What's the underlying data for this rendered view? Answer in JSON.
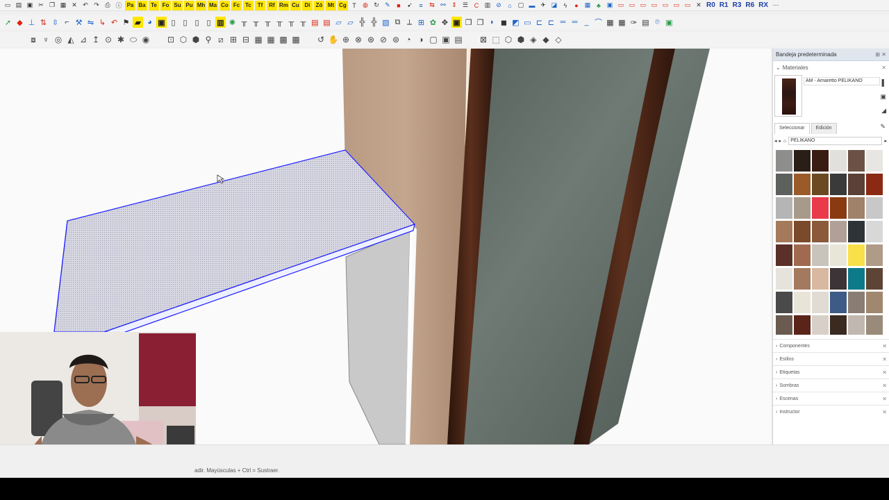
{
  "toolbars": {
    "row1_codes": [
      "Pa",
      "Ba",
      "Te",
      "Fo",
      "Su",
      "Pu",
      "Mh",
      "Ma",
      "Co",
      "Fc",
      "Tc",
      "Tf",
      "Rf",
      "Rm",
      "Cu",
      "Di",
      "Zó",
      "Mt",
      "Cg"
    ],
    "row1_right_codes": [
      "R0",
      "R1",
      "R3",
      "R6",
      "RX"
    ]
  },
  "tray": {
    "title": "Bandeja predeterminada",
    "materials": {
      "section_label": "Materiales",
      "current_material": "AM - Amaretto PELIKANO",
      "tabs": [
        "Seleccionar",
        "Edición"
      ],
      "library": "PELIKANO",
      "swatch_colors": [
        "#8e8e8c",
        "#2a1e18",
        "#3a1d12",
        "#e2e0dc",
        "#6b5245",
        "#e8e6e2",
        "#5c615e",
        "#9a5a2a",
        "#6b4a22",
        "#3a3a3a",
        "#5a4036",
        "#8a2a14",
        "#b5b5b5",
        "#a89a8a",
        "#e83a4a",
        "#8a3a10",
        "#a0826a",
        "#c8c8c8",
        "#a47a5a",
        "#7a4a2a",
        "#8a5a3a",
        "#b0a098",
        "#2e3338",
        "#d8d8d8",
        "#5a3028",
        "#a06a50",
        "#c8c4bc",
        "#e8e6d8",
        "#f7e04a",
        "#b09a88",
        "#e6e3dc",
        "#a47a5e",
        "#d8b8a0",
        "#3c3436",
        "#0d7a8a",
        "#5e4434",
        "#4a4a4a",
        "#e8e4d8",
        "#e0dcd4",
        "#3e5a86",
        "#8a7e74",
        "#a0886e",
        "#6a5a50",
        "#5a2418",
        "#d8d0c8",
        "#3a2a20",
        "#c0b8b0",
        "#9a8a7a"
      ]
    },
    "collapsed_sections": [
      "Componentes",
      "Estilos",
      "Etiquetas",
      "Sombras",
      "Escenas",
      "Instructor"
    ]
  },
  "status": {
    "hint": "adir. Mayúsculas + Ctrl = Sustraer."
  }
}
